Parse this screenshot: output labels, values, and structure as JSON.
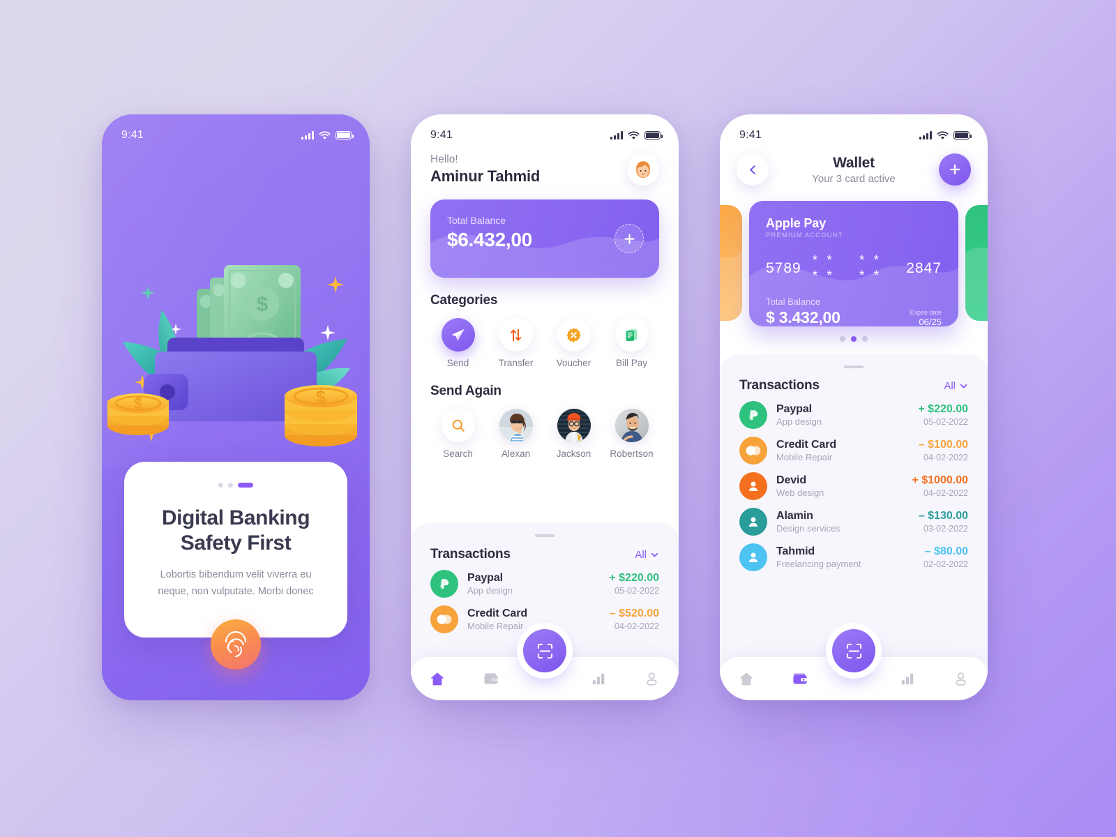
{
  "background": {
    "from": "#dcd8ec",
    "to": "#a98cf5"
  },
  "colors": {
    "purple": "#8b5cf6",
    "purple_deep": "#7f55ef",
    "green": "#2ec27e",
    "orange": "#f7a23b",
    "orange_deep": "#f47a1f",
    "teal": "#2a9d9b",
    "sky": "#4cc3f0",
    "text_dark": "#2d2d40",
    "text_muted": "#8b8b9c"
  },
  "screen1": {
    "status": {
      "time": "9:41",
      "signal_icon": "signal-bars-icon",
      "wifi_icon": "wifi-icon",
      "battery_icon": "battery-icon"
    },
    "illustration": "wallet-money-illustration",
    "pagination": {
      "dots": 3,
      "active_index": 2
    },
    "title": "Digital Banking Safety First",
    "subtitle": "Lobortis bibendum velit viverra eu neque, non vulputate. Morbi donec",
    "fingerprint_icon": "fingerprint-icon"
  },
  "screen2": {
    "status": {
      "time": "9:41"
    },
    "greeting": {
      "hello": "Hello!",
      "name": "Aminur Tahmid",
      "avatar": "user-avatar"
    },
    "balance": {
      "label": "Total Balance",
      "amount": "$6.432,00",
      "add_icon": "plus-icon"
    },
    "categories": {
      "title": "Categories",
      "items": [
        {
          "label": "Send",
          "icon": "send-paper-plane-icon",
          "active": true
        },
        {
          "label": "Transfer",
          "icon": "transfer-arrows-icon",
          "active": false
        },
        {
          "label": "Voucher",
          "icon": "voucher-percent-badge-icon",
          "active": false
        },
        {
          "label": "Bill Pay",
          "icon": "bill-receipt-icon",
          "active": false
        }
      ]
    },
    "send_again": {
      "title": "Send Again",
      "items": [
        {
          "label": "Search",
          "icon": "search-icon"
        },
        {
          "label": "Alexan",
          "icon": "contact-photo-alexan"
        },
        {
          "label": "Jackson",
          "icon": "contact-photo-jackson"
        },
        {
          "label": "Robertson",
          "icon": "contact-photo-robertson"
        }
      ]
    },
    "transactions": {
      "title": "Transactions",
      "filter_label": "All",
      "filter_icon": "chevron-down-icon",
      "rows": [
        {
          "name": "Paypal",
          "desc": "App design",
          "amount": "+ $220.00",
          "date": "05-02-2022",
          "color": "#2ec27e",
          "icon": "paypal-icon"
        },
        {
          "name": "Credit Card",
          "desc": "Mobile Repair",
          "amount": "– $520.00",
          "date": "04-02-2022",
          "color": "#f7a23b",
          "icon": "mastercard-icon"
        }
      ]
    },
    "nav": {
      "scan_icon": "scan-qr-icon",
      "items": [
        {
          "icon": "home-icon",
          "active": true
        },
        {
          "icon": "wallet-icon",
          "active": false
        },
        {
          "icon": "chart-bar-icon",
          "active": false
        },
        {
          "icon": "person-icon",
          "active": false
        }
      ]
    }
  },
  "screen3": {
    "status": {
      "time": "9:41"
    },
    "header": {
      "back_icon": "chevron-left-icon",
      "title": "Wallet",
      "subtitle": "Your 3 card active",
      "add_icon": "plus-icon"
    },
    "card": {
      "brand": "Apple Pay",
      "tier": "PREMIUM ACCOUNT",
      "number_groups": [
        "5789",
        "* * * *",
        "* * * *",
        "2847"
      ],
      "balance_label": "Total Balance",
      "balance_amount": "$ 3.432,00",
      "expire_label": "Expire date",
      "expire_value": "06/25"
    },
    "card_pager": {
      "dots": 3,
      "active_index": 1
    },
    "transactions": {
      "title": "Transactions",
      "filter_label": "All",
      "filter_icon": "chevron-down-icon",
      "rows": [
        {
          "name": "Paypal",
          "desc": "App design",
          "amount": "+ $220.00",
          "date": "05-02-2022",
          "color": "#2ec27e",
          "icon": "paypal-icon"
        },
        {
          "name": "Credit Card",
          "desc": "Mobile Repair",
          "amount": "– $100.00",
          "date": "04-02-2022",
          "color": "#f7a23b",
          "icon": "mastercard-icon"
        },
        {
          "name": "Devid",
          "desc": "Web design",
          "amount": "+ $1000.00",
          "date": "04-02-2022",
          "color": "#f4701f",
          "icon": "person-avatar-icon"
        },
        {
          "name": "Alamin",
          "desc": "Design services",
          "amount": "– $130.00",
          "date": "03-02-2022",
          "color": "#2a9d9b",
          "icon": "person-avatar-icon"
        },
        {
          "name": "Tahmid",
          "desc": "Freelancing payment",
          "amount": "– $80.00",
          "date": "02-02-2022",
          "color": "#4cc3f0",
          "icon": "person-avatar-icon"
        }
      ]
    },
    "nav": {
      "scan_icon": "scan-qr-icon",
      "items": [
        {
          "icon": "home-icon",
          "active": false
        },
        {
          "icon": "wallet-icon",
          "active": true
        },
        {
          "icon": "chart-bar-icon",
          "active": false
        },
        {
          "icon": "person-icon",
          "active": false
        }
      ]
    }
  }
}
